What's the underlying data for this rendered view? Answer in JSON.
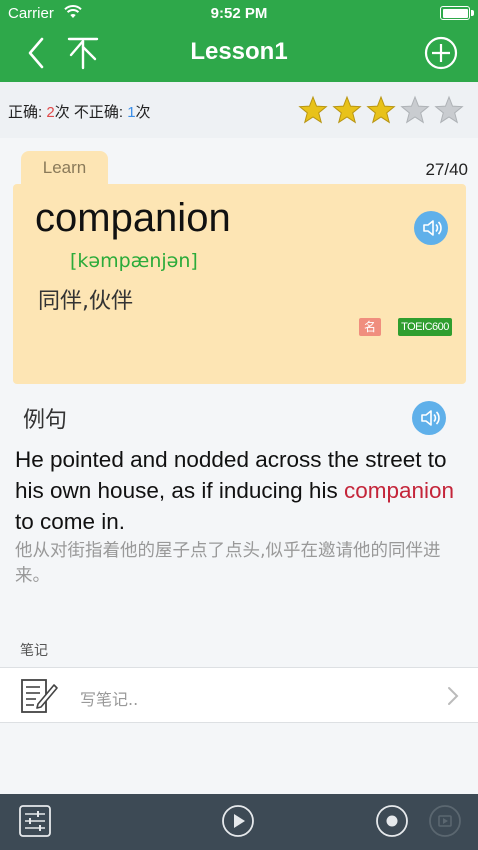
{
  "status_bar": {
    "carrier": "Carrier",
    "time": "9:52 PM"
  },
  "nav": {
    "title": "Lesson1",
    "back_icon": "chevron-left-icon",
    "top_icon": "scroll-to-top-icon",
    "add_icon": "plus-circle-icon"
  },
  "stats": {
    "correct_label": "正确: ",
    "correct_count": "2",
    "correct_unit": "次 ",
    "incorrect_label": "不正确: ",
    "incorrect_count": "1",
    "incorrect_unit": "次",
    "rating": 3,
    "rating_max": 5
  },
  "card": {
    "tab": "Learn",
    "counter": "27/40",
    "word": "companion",
    "phonetic": "[kəmpænjən]",
    "meaning": "同伴,伙伴",
    "tags": [
      "名",
      "TOEIC600"
    ]
  },
  "example": {
    "title": "例句",
    "en_before": "He pointed and nodded across the street to his own house, as if inducing his ",
    "en_highlight": "companion",
    "en_after": " to come in.",
    "zh": "他从对街指着他的屋子点了点头,似乎在邀请他的同伴进来。"
  },
  "notes": {
    "label": "笔记",
    "placeholder": "写笔记.."
  },
  "colors": {
    "nav_green": "#2ea84a",
    "card_bg": "#fde5b4",
    "phonetic_green": "#2bab3a",
    "highlight_red": "#c4253a",
    "speaker_blue": "#5fb0ea",
    "star_gold": "#e8c21a",
    "bottom_bar": "#3d4a55"
  }
}
